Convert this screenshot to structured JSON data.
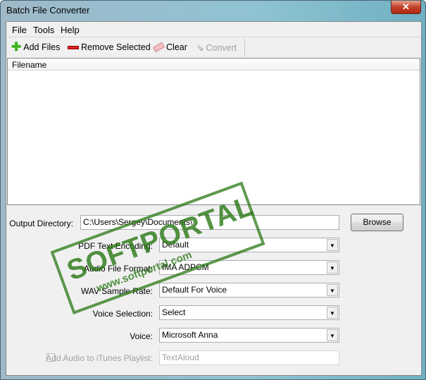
{
  "window": {
    "title": "Batch File Converter",
    "close": "✕"
  },
  "menu": [
    "File",
    "Tools",
    "Help"
  ],
  "toolbar": {
    "add": "Add Files",
    "remove": "Remove Selected",
    "clear": "Clear",
    "convert": "Convert"
  },
  "list": {
    "header": "Filename"
  },
  "form": {
    "output_label": "Output Directory:",
    "output_value": "C:\\Users\\Sergey\\Documents\\",
    "browse": "Browse",
    "pdf_label": "PDF Text Encoding:",
    "pdf_value": "Default",
    "format_label": "Audio File Format:",
    "format_value": "IMA ADPCM",
    "rate_label": "WAV Sample Rate:",
    "rate_value": "Default For Voice",
    "voicesel_label": "Voice Selection:",
    "voicesel_value": "Select",
    "voice_label": "Voice:",
    "voice_value": "Microsoft Anna",
    "itunes_label": "Add Audio to iTunes Playlist:",
    "itunes_value": "TextAloud",
    "itunes_checked": false
  },
  "watermark": {
    "text": "SOFTPORTAL",
    "url": "www.softportal.com"
  }
}
